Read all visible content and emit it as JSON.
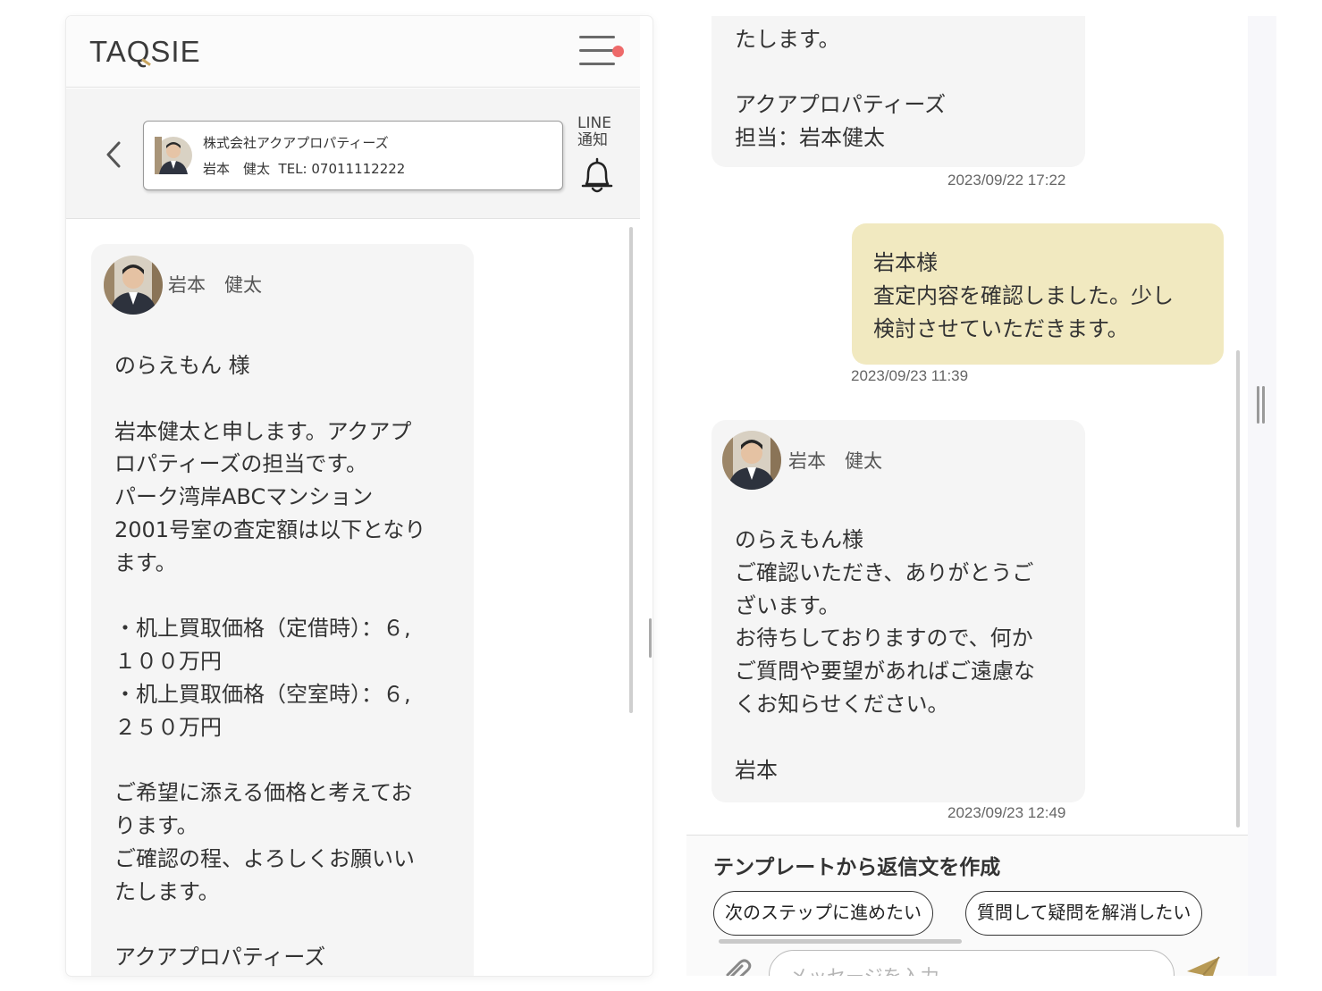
{
  "app": {
    "logo_text": "TAQSIE",
    "logo_accent_color": "#c8a45e",
    "notification_dot_color": "#ee6a6a"
  },
  "contact": {
    "company": "株式会社アクアプロパティーズ",
    "person": "岩本　健太  TEL: 07011112222",
    "line_notify_label": "LINE\n通知"
  },
  "messages": [
    {
      "direction": "incoming",
      "sender": "岩本　健太",
      "text": "のらえもん 様\n\n岩本健太と申します。アクアプ\nロパティーズの担当です。\nパーク湾岸ABCマンション\n2001号室の査定額は以下となり\nます。\n\n・机上買取価格（定借時）：６,\n１００万円\n・机上買取価格（空室時）：６,\n２５０万円\n\nご希望に添える価格と考えてお\nります。\nご確認の程、よろしくお願いい\nたします。\n\nアクアプロパティーズ\n担当：岩本健太",
      "time": "2023/09/22 17:22"
    },
    {
      "direction": "outgoing",
      "text": "岩本様\n査定内容を確認しました。少し\n検討させていただきます。",
      "time": "2023/09/23 11:39",
      "bubble_color": "#f1e9c0"
    },
    {
      "direction": "incoming",
      "sender": "岩本　健太",
      "text": "のらえもん様\nご確認いただき、ありがとうご\nざいます。\nお待ちしておりますので、何か\nご質問や要望があればご遠慮な\nくお知らせください。\n\n岩本",
      "time": "2023/09/23 12:49"
    }
  ],
  "reply": {
    "template_title": "テンプレートから返信文を作成",
    "templates": [
      "次のステップに進めたい",
      "質問して疑問を解消したい"
    ],
    "input_placeholder": "メッセージを入力"
  }
}
